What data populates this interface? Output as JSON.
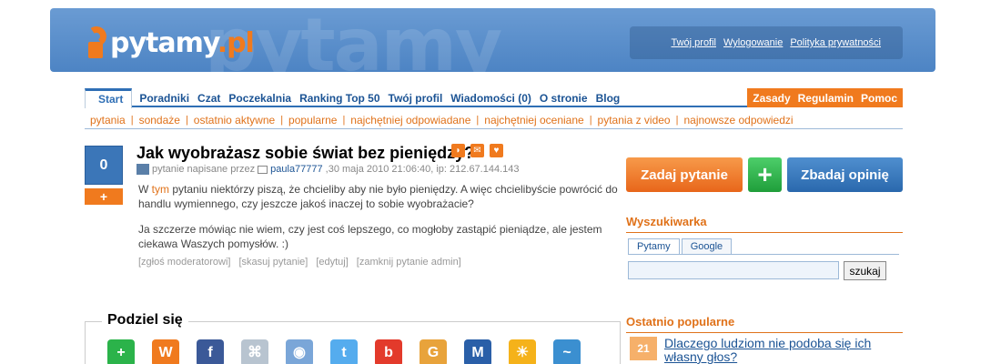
{
  "header": {
    "logo_text": "pytamy",
    "logo_tld": ".pl",
    "watermark": "pytamy",
    "user_links": [
      "Twój profil",
      "Wylogowanie",
      "Polityka prywatności"
    ]
  },
  "nav": {
    "items": [
      "Start",
      "Poradniki",
      "Czat",
      "Poczekalnia",
      "Ranking Top 50",
      "Twój profil",
      "Wiadomości (0)",
      "O stronie",
      "Blog"
    ],
    "right_items": [
      "Zasady",
      "Regulamin",
      "Pomoc"
    ]
  },
  "subnav": {
    "items": [
      "pytania",
      "sondaże",
      "ostatnio aktywne",
      "popularne",
      "najchętniej odpowiadane",
      "najchętniej oceniane",
      "pytania z video",
      "najnowsze odpowiedzi"
    ]
  },
  "question": {
    "votes": "0",
    "vote_plus": "+",
    "title": "Jak wyobrażasz sobie świat bez pieniędzy?",
    "meta_prefix": "pytanie napisane przez",
    "author": "paula77777",
    "meta_suffix": ",30 maja 2010 21:06:40, ip: 212.67.144.143",
    "body_p1_pre": "W ",
    "body_p1_link": "tym",
    "body_p1_post": " pytaniu niektórzy piszą, że chcieliby aby nie było pieniędzy. A więc chcielibyście powrócić do handlu wymiennego, czy jeszcze jakoś inaczej to sobie wyobrażacie?",
    "body_p2": "Ja szczerze mówiąc nie wiem, czy jest coś lepszego, co mogłoby zastąpić pieniądze, ale jestem ciekawa Waszych pomysłów. :)",
    "actions": [
      "[zgłoś moderatorowi]",
      "[skasuj pytanie]",
      "[edytuj]",
      "[zamknij pytanie admin]"
    ]
  },
  "share": {
    "title": "Podziel się",
    "icons": [
      {
        "name": "add-icon",
        "glyph": "+",
        "color": "#2bb34a"
      },
      {
        "name": "wykop-icon",
        "glyph": "W",
        "color": "#f07a1e"
      },
      {
        "name": "facebook-icon",
        "glyph": "f",
        "color": "#3b5998"
      },
      {
        "name": "network-icon",
        "glyph": "⌘",
        "color": "#b8c4d0"
      },
      {
        "name": "mouse-icon",
        "glyph": "◉",
        "color": "#7aa6d8"
      },
      {
        "name": "twitter-icon",
        "glyph": "t",
        "color": "#55acee"
      },
      {
        "name": "blip-icon",
        "glyph": "b",
        "color": "#e33a2b"
      },
      {
        "name": "google-buzz-icon",
        "glyph": "G",
        "color": "#e8a33b"
      },
      {
        "name": "myspace-icon",
        "glyph": "M",
        "color": "#2a5fa8"
      },
      {
        "name": "sun-icon",
        "glyph": "☀",
        "color": "#f5b21a"
      },
      {
        "name": "fish-icon",
        "glyph": "~",
        "color": "#3b8fd0"
      }
    ]
  },
  "sidebar": {
    "ask_button": "Zadaj pytanie",
    "plus_button": "+",
    "opinion_button": "Zbadaj opinię",
    "search_heading": "Wyszukiwarka",
    "search_tabs": [
      "Pytamy",
      "Google"
    ],
    "search_value": "",
    "search_button": "szukaj",
    "popular_heading": "Ostatnio popularne",
    "popular_rank": "21",
    "popular_link": "Dlaczego ludziom nie podoba się ich własny głos?"
  }
}
